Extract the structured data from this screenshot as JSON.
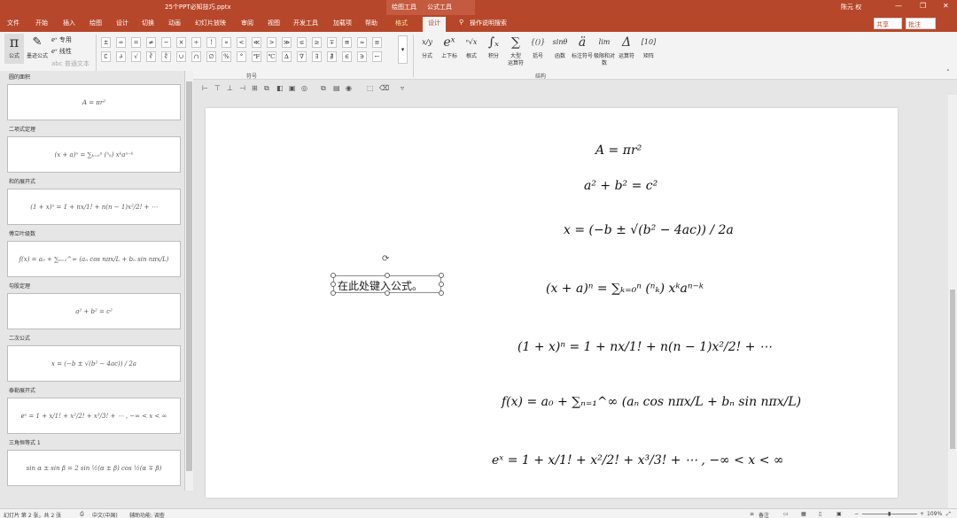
{
  "title_bar": {
    "filename": "25个PPT必知技巧.pptx",
    "context_group_drawing": "绘图工具",
    "context_group_equation": "公式工具",
    "user": "陈元 权",
    "minimize": "—",
    "restore": "❐",
    "close": "✕"
  },
  "tabs": [
    "文件",
    "开始",
    "插入",
    "绘图",
    "设计",
    "切换",
    "动画",
    "幻灯片放映",
    "审阅",
    "视图",
    "开发工具",
    "加载项",
    "帮助",
    "格式",
    "设计"
  ],
  "tell_me": "操作说明搜索",
  "share": "共享",
  "comments": "批注",
  "ribbon": {
    "equation_label": "公式",
    "ink_equation_label": "墨迹公式",
    "professional": "专用",
    "linear": "线性",
    "normal_text": "普通文本",
    "tools_group": "工具",
    "symbols_group": "符号",
    "structures_group": "结构",
    "symbols_row1": [
      "±",
      "∞",
      "=",
      "≠",
      "~",
      "×",
      "÷",
      "!",
      "∝",
      "<",
      "≪",
      ">",
      "≫",
      "≤",
      "≥",
      "∓",
      "≅",
      "≈",
      "≡"
    ],
    "symbols_row2": [
      "∁",
      "∂",
      "√",
      "∛",
      "∜",
      "∪",
      "∩",
      "∅",
      "%",
      "°",
      "℉",
      "℃",
      "∆",
      "∇",
      "∃",
      "∄",
      "∈",
      "∋",
      "←"
    ],
    "structures": [
      {
        "icon": "x/y",
        "label": "分式"
      },
      {
        "icon": "eˣ",
        "label": "上下标"
      },
      {
        "icon": "ⁿ√x",
        "label": "根式"
      },
      {
        "icon": "∫ₓ",
        "label": "积分"
      },
      {
        "icon": "∑",
        "label": "大型\n运算符"
      },
      {
        "icon": "{()}",
        "label": "括号"
      },
      {
        "icon": "sinθ",
        "label": "函数"
      },
      {
        "icon": "ä",
        "label": "标注符号"
      },
      {
        "icon": "lim",
        "label": "极限和对数"
      },
      {
        "icon": "Δ",
        "label": "运算符"
      },
      {
        "icon": "[10]",
        "label": "矩阵"
      }
    ]
  },
  "slides_panel": [
    {
      "title": "圆的面积",
      "formula": "A = πr²"
    },
    {
      "title": "二项式定理",
      "formula": "(x + a)ⁿ = ∑ₖ₌₀ⁿ (ⁿₖ) xᵏaⁿ⁻ᵏ"
    },
    {
      "title": "和的展开式",
      "formula": "(1 + x)ⁿ = 1 + nx/1! + n(n − 1)x²/2! + ⋯"
    },
    {
      "title": "傅立叶级数",
      "formula": "f(x) = a₀ + ∑ₙ₌₁^∞ (aₙ cos nπx/L + bₙ sin nπx/L)"
    },
    {
      "title": "勾股定理",
      "formula": "a² + b² = c²"
    },
    {
      "title": "二次公式",
      "formula": "x = (−b ± √(b² − 4ac)) / 2a"
    },
    {
      "title": "泰勒展开式",
      "formula": "eˣ = 1 + x/1! + x²/2! + x³/3! + ⋯ ,   −∞ < x < ∞"
    },
    {
      "title": "三角恒等式 1",
      "formula": "sin α ± sin β = 2 sin ½(α ± β) cos ½(α ∓ β)"
    }
  ],
  "slide": {
    "placeholder_text": "在此处键入公式。",
    "equations": [
      "A = πr²",
      "a² + b² = c²",
      "x = (−b ± √(b² − 4ac)) / 2a",
      "(x + a)ⁿ = ∑ₖ₌₀ⁿ (ⁿₖ) xᵏaⁿ⁻ᵏ",
      "(1 + x)ⁿ = 1 + nx/1! + n(n − 1)x²/2! + ⋯",
      "f(x) = a₀ + ∑ₙ₌₁^∞ (aₙ cos nπx/L + bₙ sin nπx/L)",
      "eˣ = 1 + x/1! + x²/2! + x³/3! + ⋯ ,     −∞ < x < ∞"
    ]
  },
  "status": {
    "slide_count": "幻灯片 第 2 张，共 2 张",
    "language": "中文(中国)",
    "accessibility": "辅助功能: 调查",
    "notes": "备注",
    "zoom": "109%"
  },
  "colors": {
    "accent": "#b7472a",
    "ribbon_bg": "#f3f3f3"
  }
}
